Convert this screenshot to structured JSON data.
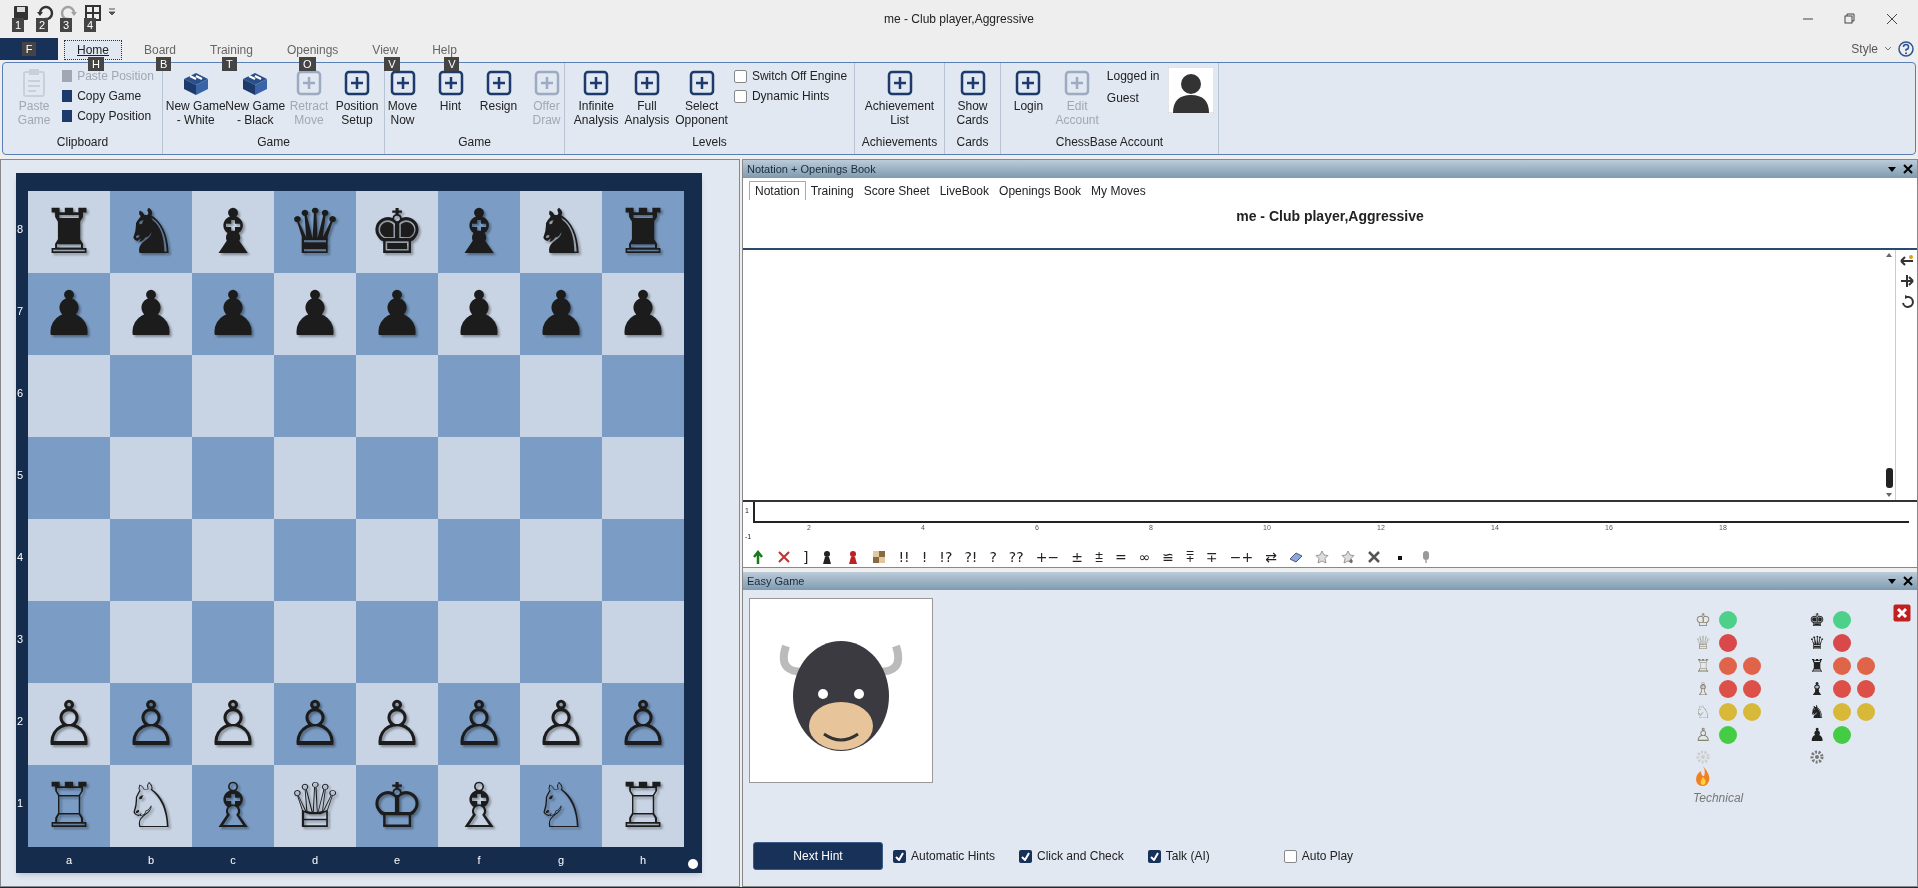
{
  "window": {
    "title": "me - Club player,Aggressive"
  },
  "quick_access": [
    {
      "keytip": "1",
      "disabled": false
    },
    {
      "keytip": "2",
      "disabled": false
    },
    {
      "keytip": "3",
      "disabled": true
    },
    {
      "keytip": "4",
      "disabled": false
    }
  ],
  "file_tab": {
    "keytip": "F"
  },
  "tabs": [
    {
      "label": "Home",
      "keytip": "H",
      "selected": true
    },
    {
      "label": "Board",
      "keytip": "B",
      "selected": false
    },
    {
      "label": "Training",
      "keytip": "T",
      "selected": false
    },
    {
      "label": "Openings",
      "keytip": "O",
      "selected": false
    },
    {
      "label": "View",
      "keytip": "V",
      "selected": false
    },
    {
      "label": "Help",
      "keytip": "V",
      "selected": false
    }
  ],
  "style_menu": {
    "label": "Style"
  },
  "ribbon": [
    {
      "label": "Clipboard",
      "items": [
        {
          "kind": "large",
          "label": "Paste\nGame",
          "disabled": true
        },
        {
          "kind": "small",
          "label": "Paste Position",
          "disabled": true
        },
        {
          "kind": "small",
          "label": "Copy Game",
          "disabled": false
        },
        {
          "kind": "small",
          "label": "Copy Position",
          "disabled": false
        }
      ]
    },
    {
      "label": "Game",
      "items": [
        {
          "kind": "large",
          "label": "New Game\n- White",
          "disabled": false
        },
        {
          "kind": "large",
          "label": "New Game\n- Black",
          "disabled": false
        },
        {
          "kind": "large",
          "label": "Retract\nMove",
          "disabled": true
        },
        {
          "kind": "large",
          "label": "Position\nSetup",
          "disabled": false
        }
      ]
    },
    {
      "label": "Game",
      "items": [
        {
          "kind": "large",
          "label": "Move\nNow",
          "disabled": false
        },
        {
          "kind": "large",
          "label": "Hint",
          "disabled": false
        },
        {
          "kind": "large",
          "label": "Resign",
          "disabled": false
        },
        {
          "kind": "large",
          "label": "Offer\nDraw",
          "disabled": true
        }
      ]
    },
    {
      "label": "Levels",
      "items": [
        {
          "kind": "large",
          "label": "Infinite\nAnalysis",
          "disabled": false
        },
        {
          "kind": "large",
          "label": "Full\nAnalysis",
          "disabled": false
        },
        {
          "kind": "large",
          "label": "Select\nOpponent",
          "disabled": false
        },
        {
          "kind": "check",
          "label": "Switch Off Engine",
          "checked": false
        },
        {
          "kind": "check",
          "label": "Dynamic Hints",
          "checked": false
        }
      ]
    },
    {
      "label": "Achievements",
      "items": [
        {
          "kind": "large",
          "label": "Achievement\nList",
          "disabled": false
        }
      ]
    },
    {
      "label": "Cards",
      "items": [
        {
          "kind": "large",
          "label": "Show\nCards",
          "disabled": false
        }
      ]
    },
    {
      "label": "ChessBase Account",
      "items": [
        {
          "kind": "large",
          "label": "Login",
          "disabled": false
        },
        {
          "kind": "large",
          "label": "Edit\nAccount",
          "disabled": true
        },
        {
          "kind": "status",
          "lines": [
            "Logged in",
            "Guest"
          ]
        },
        {
          "kind": "avatar"
        }
      ]
    }
  ],
  "board": {
    "files": [
      "a",
      "b",
      "c",
      "d",
      "e",
      "f",
      "g",
      "h"
    ],
    "ranks": [
      {
        "label": "8",
        "pieces": [
          "♜",
          "♞",
          "♝",
          "♛",
          "♚",
          "♝",
          "♞",
          "♜"
        ]
      },
      {
        "label": "7",
        "pieces": [
          "♟",
          "♟",
          "♟",
          "♟",
          "♟",
          "♟",
          "♟",
          "♟"
        ]
      },
      {
        "label": "6"
      },
      {
        "label": "5"
      },
      {
        "label": "4"
      },
      {
        "label": "3"
      },
      {
        "label": "2",
        "pieces": [
          "♙",
          "♙",
          "♙",
          "♙",
          "♙",
          "♙",
          "♙",
          "♙"
        ]
      },
      {
        "label": "1",
        "pieces": [
          "♖",
          "♘",
          "♗",
          "♕",
          "♔",
          "♗",
          "♘",
          "♖"
        ]
      }
    ]
  },
  "notation": {
    "title": "Notation + Openings Book",
    "tabs": [
      {
        "label": "Notation",
        "selected": true
      },
      {
        "label": "Training",
        "selected": false
      },
      {
        "label": "Score Sheet",
        "selected": false
      },
      {
        "label": "LiveBook",
        "selected": false
      },
      {
        "label": "Openings Book",
        "selected": false
      },
      {
        "label": "My Moves",
        "selected": false
      }
    ],
    "game_title": "me - Club player,Aggressive",
    "timeline": {
      "y_labels": [
        "1",
        "-1"
      ],
      "x_labels": [
        "2",
        "4",
        "6",
        "8",
        "10",
        "12",
        "14",
        "16",
        "18"
      ]
    },
    "toolbar": [
      {
        "kind": "arrow"
      },
      {
        "kind": "cross"
      },
      {
        "kind": "symbol",
        "text": "]"
      },
      {
        "kind": "piece"
      },
      {
        "kind": "redpiece"
      },
      {
        "kind": "board"
      },
      {
        "kind": "symbol",
        "text": "!!"
      },
      {
        "kind": "symbol",
        "text": "!"
      },
      {
        "kind": "symbol",
        "text": "!?"
      },
      {
        "kind": "symbol",
        "text": "?!"
      },
      {
        "kind": "symbol",
        "text": "?"
      },
      {
        "kind": "symbol",
        "text": "??"
      },
      {
        "kind": "symbol",
        "text": "+−"
      },
      {
        "kind": "symbol",
        "text": "±"
      },
      {
        "kind": "symbol",
        "text": "⩲"
      },
      {
        "kind": "symbol",
        "text": "="
      },
      {
        "kind": "symbol",
        "text": "∞"
      },
      {
        "kind": "symbol",
        "text": "≌"
      },
      {
        "kind": "symbol",
        "text": "⩱"
      },
      {
        "kind": "symbol",
        "text": "∓"
      },
      {
        "kind": "symbol",
        "text": "−+"
      },
      {
        "kind": "symbol",
        "text": "⇄"
      },
      {
        "kind": "eraser"
      },
      {
        "kind": "star"
      },
      {
        "kind": "starplus"
      },
      {
        "kind": "tools"
      },
      {
        "kind": "dot"
      },
      {
        "kind": "mic"
      }
    ]
  },
  "easy_game": {
    "title": "Easy Game",
    "material": [
      {
        "rows": [
          {
            "piece": "♔",
            "dots": [
              {
                "color": "#4cd08a"
              }
            ]
          },
          {
            "piece": "♕",
            "dots": [
              {
                "color": "#d9484a"
              }
            ]
          },
          {
            "piece": "♖",
            "dots": [
              {
                "color": "#e0644a"
              },
              {
                "color": "#e0644a"
              }
            ]
          },
          {
            "piece": "♗",
            "dots": [
              {
                "color": "#dc5048"
              },
              {
                "color": "#dc5048"
              }
            ]
          },
          {
            "piece": "♘",
            "dots": [
              {
                "color": "#d8b838"
              },
              {
                "color": "#d8b838"
              }
            ]
          },
          {
            "piece": "♙",
            "dots": [
              {
                "color": "#44cc44"
              }
            ]
          }
        ]
      },
      {
        "rows": [
          {
            "piece": "♚",
            "dots": [
              {
                "color": "#4cd08a"
              }
            ]
          },
          {
            "piece": "♛",
            "dots": [
              {
                "color": "#d9484a"
              }
            ]
          },
          {
            "piece": "♜",
            "dots": [
              {
                "color": "#e0644a"
              },
              {
                "color": "#e0644a"
              }
            ]
          },
          {
            "piece": "♝",
            "dots": [
              {
                "color": "#dc5048"
              },
              {
                "color": "#dc5048"
              }
            ]
          },
          {
            "piece": "♞",
            "dots": [
              {
                "color": "#d8b838"
              },
              {
                "color": "#d8b838"
              }
            ]
          },
          {
            "piece": "♟",
            "dots": [
              {
                "color": "#44cc44"
              }
            ]
          }
        ]
      }
    ],
    "style": "Technical",
    "next_hint": "Next Hint",
    "options": [
      {
        "label": "Automatic Hints",
        "checked": true
      },
      {
        "label": "Click and Check",
        "checked": true
      },
      {
        "label": "Talk (AI)",
        "checked": true
      },
      {
        "label": "Auto Play",
        "checked": false
      }
    ]
  }
}
